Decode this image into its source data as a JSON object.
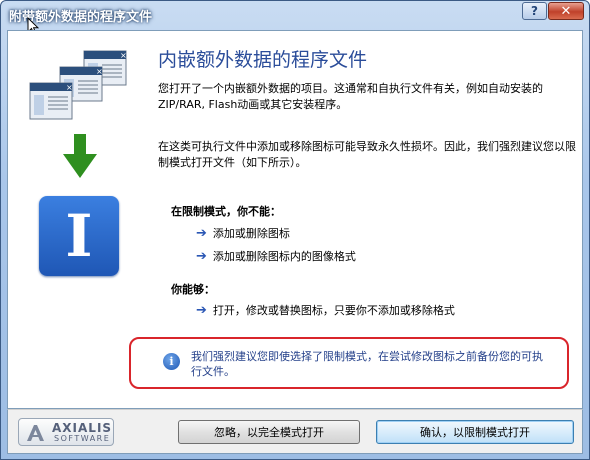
{
  "window": {
    "title": "附带额外数据的程序文件",
    "help_label": "?",
    "close_label": "✕"
  },
  "content": {
    "heading": "内嵌额外数据的程序文件",
    "paragraph1": "您打开了一个内嵌额外数据的项目。这通常和自执行文件有关，例如自动安装的ZIP/RAR, Flash动画或其它安装程序。",
    "paragraph2": "在这类可执行文件中添加或移除图标可能导致永久性损坏。因此，我们强烈建议您以限制模式打开文件（如下所示）。",
    "restricted_title": "在限制模式，你不能：",
    "cannot_items": [
      "添加或删除图标",
      "添加或删除图标内的图像格式"
    ],
    "can_title": "你能够：",
    "can_items": [
      "打开，修改或替换图标，只要你不添加或移除格式"
    ],
    "notice_text": "我们强烈建议您即使选择了限制模式，在尝试修改图标之前备份您的可执行文件。",
    "app_icon_letter": "I"
  },
  "footer": {
    "logo_name": "AXIALIS",
    "logo_sub": "SOFTWARE",
    "ignore_button": "忽略，以完全模式打开",
    "confirm_button": "确认，以限制模式打开"
  },
  "colors": {
    "accent_blue": "#2b4d9a",
    "notice_border": "#d9252b",
    "arrow_green": "#2f8f1f",
    "app_icon_blue": "#2a66c9"
  },
  "icons": [
    "cursor-icon",
    "stacked-windows-icon",
    "down-arrow-icon",
    "app-icon",
    "info-icon",
    "axialis-logo-icon",
    "right-arrow-icon"
  ]
}
